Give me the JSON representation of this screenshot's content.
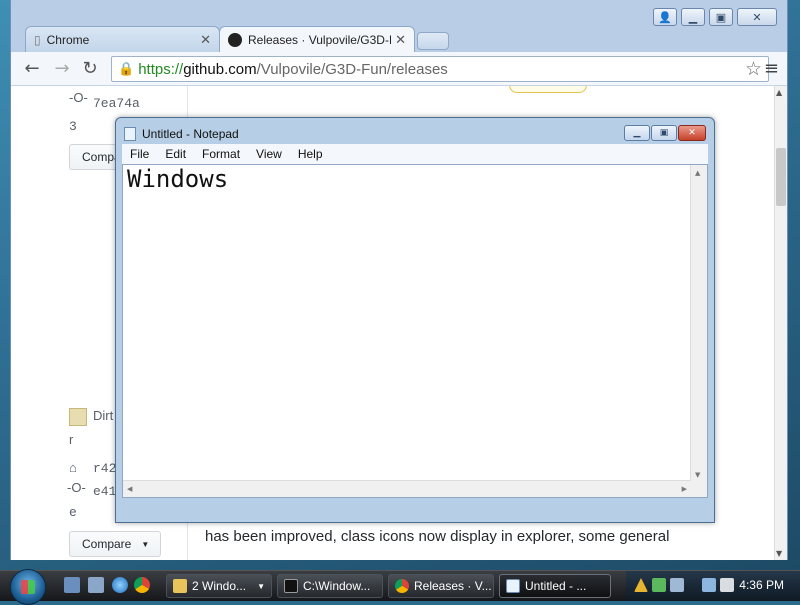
{
  "chrome": {
    "tabs": [
      {
        "label": "Chrome",
        "active": false
      },
      {
        "label": "Releases · Vulpovile/G3D-F",
        "active": true
      }
    ],
    "url": {
      "scheme": "https://",
      "host": "github.com",
      "path": "/Vulpovile/G3D-Fun/releases"
    },
    "page": {
      "commit1": "7ea74a",
      "commit1_cont": "3",
      "compare_label": "Compare",
      "author_cut": "Dirt",
      "author_cont": "r",
      "tag_cut": "r42",
      "commit2_cut": "e41",
      "commit2_cont": "e",
      "body_text": "has been improved, class icons now display in explorer, some general"
    }
  },
  "notepad": {
    "title": "Untitled - Notepad",
    "menu": [
      "File",
      "Edit",
      "Format",
      "View",
      "Help"
    ],
    "content": "Windows"
  },
  "taskbar": {
    "items": [
      {
        "label": "2 Windo...",
        "has_arrow": true,
        "active": false
      },
      {
        "label": "C:\\Window...",
        "has_arrow": false,
        "active": false
      },
      {
        "label": "Releases · V...",
        "has_arrow": false,
        "active": false
      },
      {
        "label": "Untitled - ...",
        "has_arrow": false,
        "active": true
      }
    ],
    "clock": "4:36 PM"
  },
  "colors": {
    "chrome_frame": "#b9cde6",
    "https_green": "#228a22",
    "notepad_frame": "#b7cfe6",
    "close_red": "#c6422b"
  }
}
